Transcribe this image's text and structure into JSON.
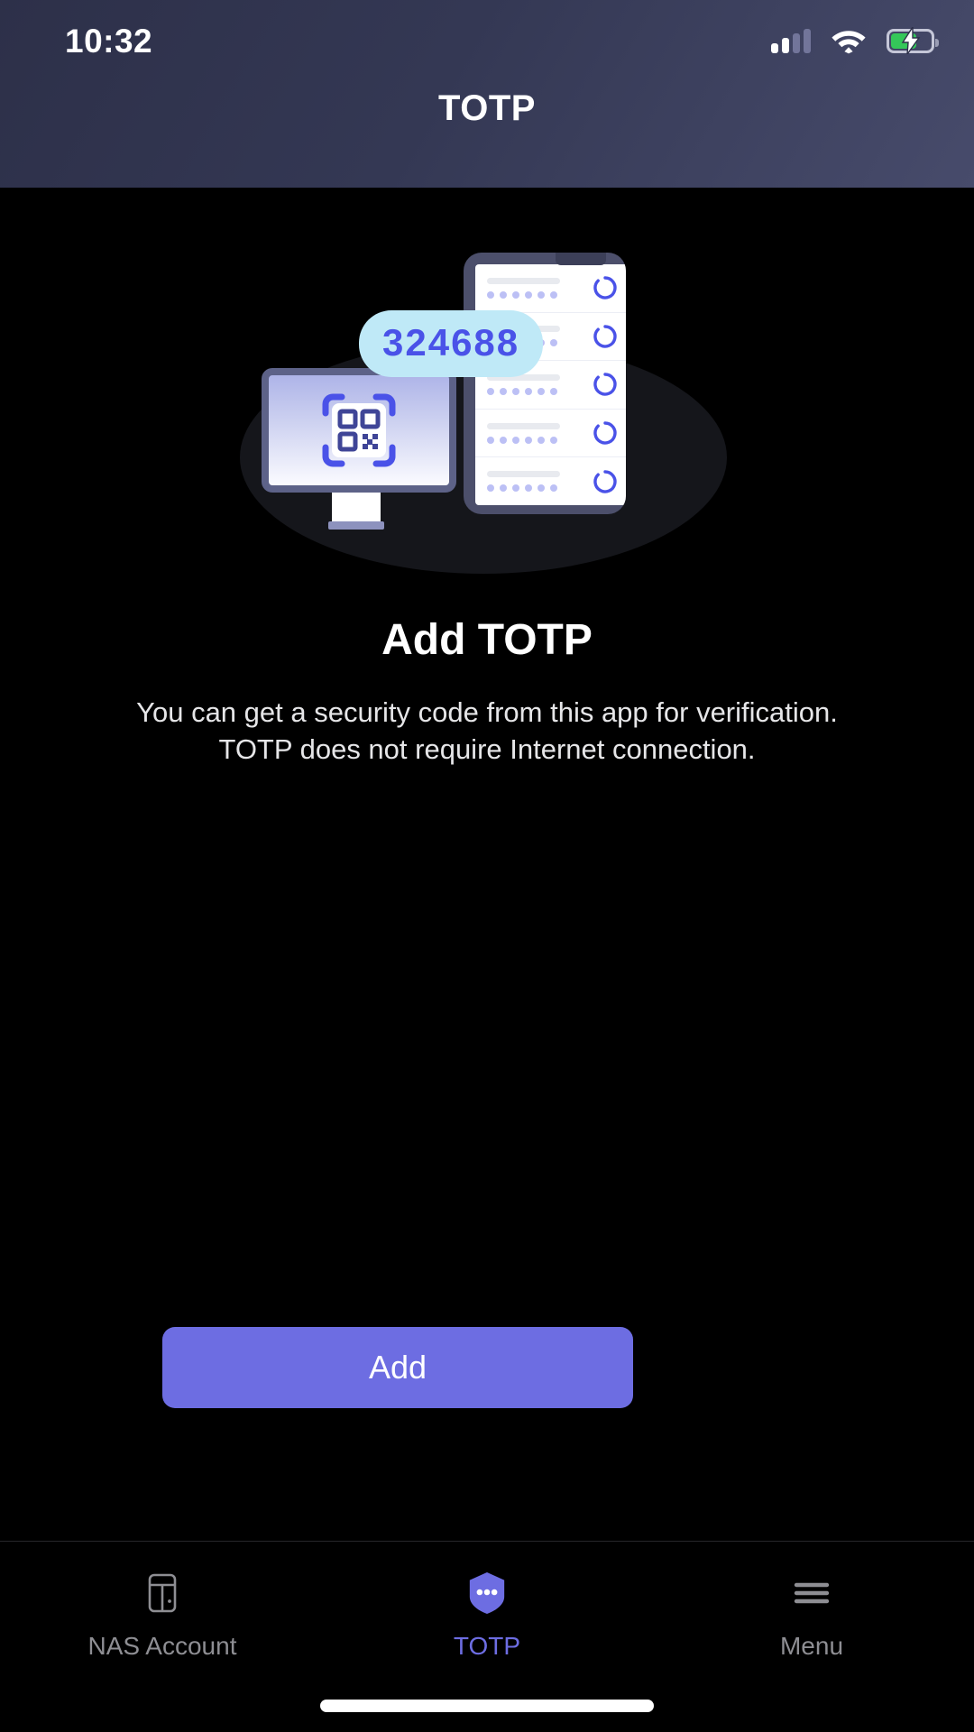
{
  "status_bar": {
    "time": "10:32",
    "signal_icon": "signal-bars-icon",
    "signal_bars_filled": 2,
    "signal_bars_total": 4,
    "wifi_icon": "wifi-icon",
    "battery_icon": "battery-charging-icon",
    "battery_level_percent": 66,
    "battery_color": "#34c759",
    "charging": true
  },
  "header": {
    "title": "TOTP",
    "gradient_from": "#2d3049",
    "gradient_to": "#474b6b"
  },
  "illustration": {
    "name": "totp-devices-illustration",
    "code_pill_value": "324688",
    "code_pill_bg": "#bfe9f7",
    "code_pill_text_color": "#4a52e8",
    "monitor_icon": "qr-code-scan-icon",
    "phone_rows": 5,
    "phone_row_dots": 6,
    "ring_color": "#4a52e8",
    "dot_color": "#bcc0f5"
  },
  "main": {
    "heading": "Add TOTP",
    "description": "You can get a security code from this app for verification. TOTP does not require Internet connection."
  },
  "primary_action": {
    "label": "Add",
    "bg_color": "#6d6de2",
    "text_color": "#ffffff"
  },
  "tab_bar": {
    "active_color": "#6d6de2",
    "inactive_color": "#8e8e93",
    "items": [
      {
        "label": "NAS Account",
        "icon": "nas-server-icon",
        "active": false
      },
      {
        "label": "TOTP",
        "icon": "shield-dots-icon",
        "active": true
      },
      {
        "label": "Menu",
        "icon": "hamburger-menu-icon",
        "active": false
      }
    ]
  }
}
